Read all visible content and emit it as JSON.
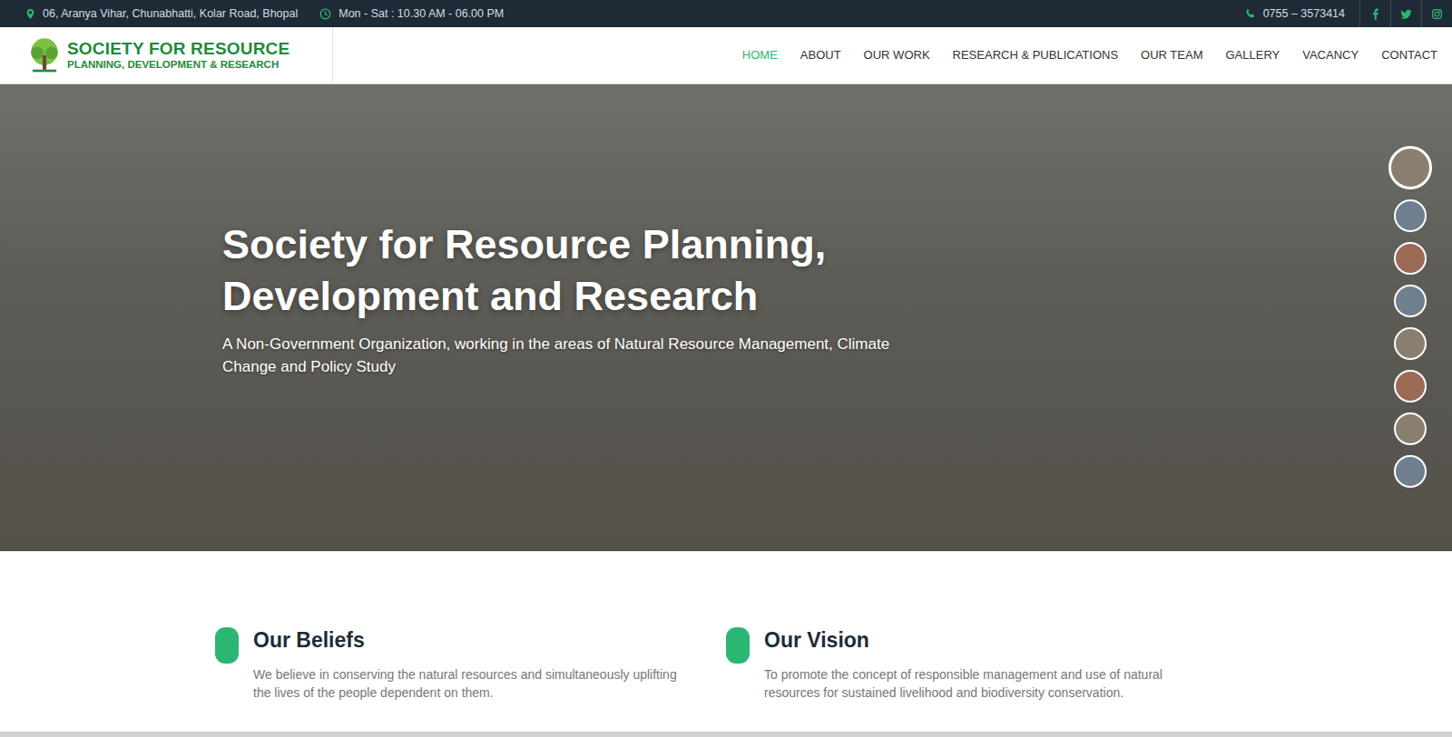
{
  "topbar": {
    "address": "06, Aranya Vihar, Chunabhatti, Kolar Road, Bhopal",
    "hours": "Mon - Sat : 10.30 AM - 06.00 PM",
    "phone": "0755 – 3573414"
  },
  "logo": {
    "line1": "SOCIETY FOR RESOURCE",
    "line2": "PLANNING, DEVELOPMENT & RESEARCH"
  },
  "nav": [
    {
      "label": "HOME",
      "selected": true
    },
    {
      "label": "ABOUT",
      "selected": false
    },
    {
      "label": "OUR WORK",
      "selected": false
    },
    {
      "label": "RESEARCH & PUBLICATIONS",
      "selected": false
    },
    {
      "label": "OUR TEAM",
      "selected": false
    },
    {
      "label": "GALLERY",
      "selected": false
    },
    {
      "label": "VACANCY",
      "selected": false
    },
    {
      "label": "CONTACT",
      "selected": false
    }
  ],
  "hero": {
    "title": "Society for Resource Planning, Development and Research",
    "subtitle": "A Non-Government Organization, working in the areas of Natural Resource Management, Climate Change and Policy Study",
    "slides": [
      {
        "selected": true
      },
      {
        "selected": false
      },
      {
        "selected": false
      },
      {
        "selected": false
      },
      {
        "selected": false
      },
      {
        "selected": false
      },
      {
        "selected": false
      },
      {
        "selected": false
      }
    ]
  },
  "features": [
    {
      "title": "Our Beliefs",
      "text": "We believe in conserving the natural resources and simultaneously uplifting the lives of the people dependent on them."
    },
    {
      "title": "Our Vision",
      "text": "To promote the concept of responsible management and use of natural resources for sustained livelihood and biodiversity conservation."
    }
  ]
}
